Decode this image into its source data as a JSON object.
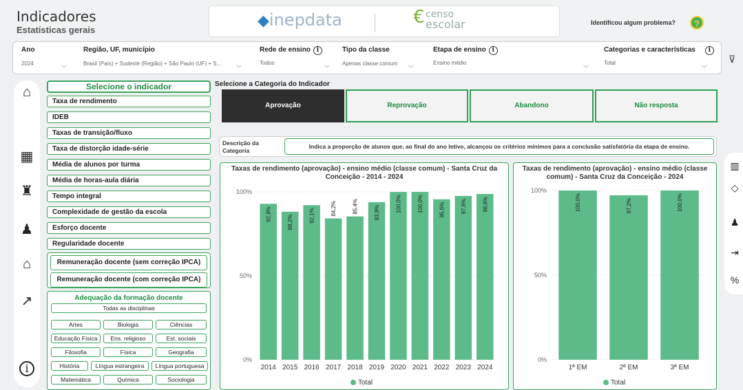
{
  "header": {
    "title": "Indicadores",
    "subtitle": "Estatísticas gerais",
    "logo_inep": "inepdata",
    "logo_censo_line1": "censo",
    "logo_censo_line2": "escolar",
    "problem_text": "Identificou algum problema?"
  },
  "filters": {
    "ano": {
      "label": "Ano",
      "value": "2024"
    },
    "regiao": {
      "label": "Região, UF, município",
      "value": "Brasil (País) + Sudeste (Região) + São Paulo (UF) + S..."
    },
    "rede": {
      "label": "Rede de ensino",
      "value": "Todos"
    },
    "tipo": {
      "label": "Tipo da classe",
      "value": "Apenas classe comum"
    },
    "etapa": {
      "label": "Etapa de ensino",
      "value": "Ensino médio"
    },
    "categorias": {
      "label": "Categorias e características",
      "value": "Total"
    }
  },
  "indicators": {
    "title": "Selecione o indicador",
    "items": [
      "Taxa de rendimento",
      "IDEB",
      "Taxas de transição/fluxo",
      "Taxa de distorção idade-série",
      "Média de alunos por turma",
      "Média de horas-aula diária",
      "Tempo integral",
      "Complexidade de gestão da escola",
      "Esforço docente",
      "Regularidade docente"
    ],
    "rem_sem": "Remuneração docente (sem correção IPCA)",
    "rem_com": "Remuneração docente (com correção IPCA)",
    "formacao_title": "Adequação da formação docente",
    "disciplinas": {
      "todas": "Todas as disciplinas",
      "artes": "Artes",
      "biologia": "Biologia",
      "ciencias": "Ciências",
      "ed_fisica": "Educação Física",
      "ens_religioso": "Ens. religioso",
      "est_sociais": "Est. sociais",
      "filosofia": "Filosofia",
      "fisica": "Física",
      "geografia": "Geografia",
      "historia": "História",
      "lingua_estrangeira": "Língua estrangeira",
      "lingua_portuguesa": "Língua portuguesa",
      "matematica": "Matemática",
      "quimica": "Química",
      "sociologia": "Sociologia"
    }
  },
  "category": {
    "heading": "Selecione a Categoria do Indicador",
    "aprovacao": "Aprovação",
    "reprovacao": "Reprovação",
    "abandono": "Abandono",
    "nao_resposta": "Não resposta",
    "active": "Aprovação"
  },
  "description": {
    "label_line1": "Descrição da",
    "label_line2": "Categoria",
    "text": "Indica a proporção de alunos que, ao final do ano letivo, alcançou os critérios mínimos para a conclusão satisfatória da etapa de ensino."
  },
  "colors": {
    "bar": "#5dbb8a",
    "accent": "#2f9e55"
  },
  "chart_data": [
    {
      "type": "bar",
      "title_line1": "Taxas de rendimento (aprovação) - ensino médio (classe comum) - Santa Cruz da",
      "title_line2": "Conceição - 2014 - 2024",
      "categories": [
        "2014",
        "2015",
        "2016",
        "2017",
        "2018",
        "2019",
        "2020",
        "2021",
        "2022",
        "2023",
        "2024"
      ],
      "values": [
        92.9,
        88.2,
        92.1,
        84.2,
        85.4,
        93.9,
        100.0,
        100.0,
        95.6,
        97.6,
        98.8
      ],
      "data_labels": [
        "92,9%",
        "88,2%",
        "92,1%",
        "84,2%",
        "85,4%",
        "93,9%",
        "100,0%",
        "100,0%",
        "95,6%",
        "97,6%",
        "98,8%"
      ],
      "y_ticks": [
        "0%",
        "50%",
        "100%"
      ],
      "ylim": [
        0,
        100
      ],
      "legend": "Total",
      "legend_position": "bottom"
    },
    {
      "type": "bar",
      "title_line1": "Taxas de rendimento (aprovação) - ensino médio (classe",
      "title_line2": "comum) - Santa Cruz da Conceição - 2024",
      "categories": [
        "1ª EM",
        "2ª EM",
        "3ª EM"
      ],
      "values": [
        100.0,
        97.2,
        100.0
      ],
      "data_labels": [
        "100,0%",
        "97,2%",
        "100,0%"
      ],
      "y_ticks": [
        "0%",
        "50%",
        "100%"
      ],
      "ylim": [
        0,
        100
      ],
      "legend": "Total",
      "legend_position": "bottom"
    }
  ]
}
